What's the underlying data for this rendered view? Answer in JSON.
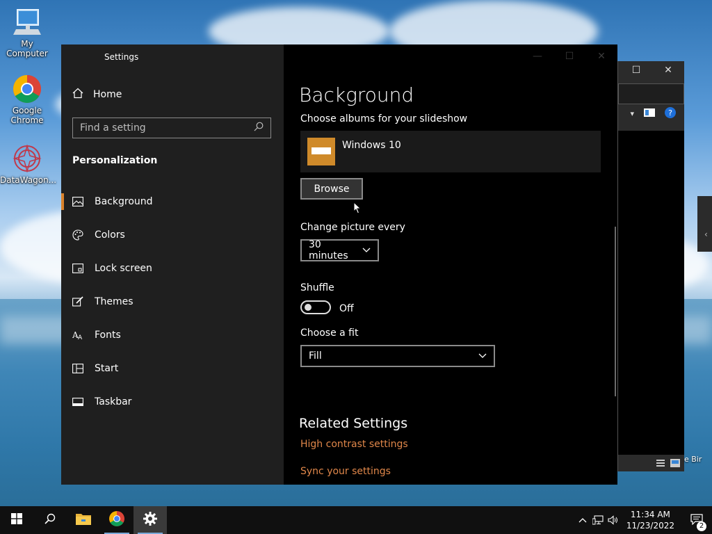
{
  "desktop": {
    "icons": [
      {
        "label": "My Computer"
      },
      {
        "label": "Google Chrome"
      },
      {
        "label": "DataWagon..."
      }
    ],
    "partial_text": "e Bir"
  },
  "settings": {
    "app_title": "Settings",
    "nav": {
      "home": "Home",
      "search_placeholder": "Find a setting",
      "section_heading": "Personalization",
      "items": [
        {
          "label": "Background",
          "icon": "picture-icon",
          "active": true
        },
        {
          "label": "Colors",
          "icon": "palette-icon"
        },
        {
          "label": "Lock screen",
          "icon": "lock-screen-icon"
        },
        {
          "label": "Themes",
          "icon": "brush-icon"
        },
        {
          "label": "Fonts",
          "icon": "font-icon"
        },
        {
          "label": "Start",
          "icon": "start-grid-icon"
        },
        {
          "label": "Taskbar",
          "icon": "taskbar-icon"
        }
      ]
    },
    "content": {
      "title": "Background",
      "albums_label": "Choose albums for your slideshow",
      "album_name": "Windows 10",
      "browse_label": "Browse",
      "change_every_label": "Change picture every",
      "change_every_value": "30 minutes",
      "shuffle_label": "Shuffle",
      "shuffle_state": "Off",
      "fit_label": "Choose a fit",
      "fit_value": "Fill",
      "related_title": "Related Settings",
      "links": [
        "High contrast settings",
        "Sync your settings"
      ]
    },
    "accent_color": "#d9822b",
    "link_color": "#e0874a"
  },
  "taskbar": {
    "time": "11:34 AM",
    "date": "11/23/2022",
    "notification_count": "2"
  }
}
